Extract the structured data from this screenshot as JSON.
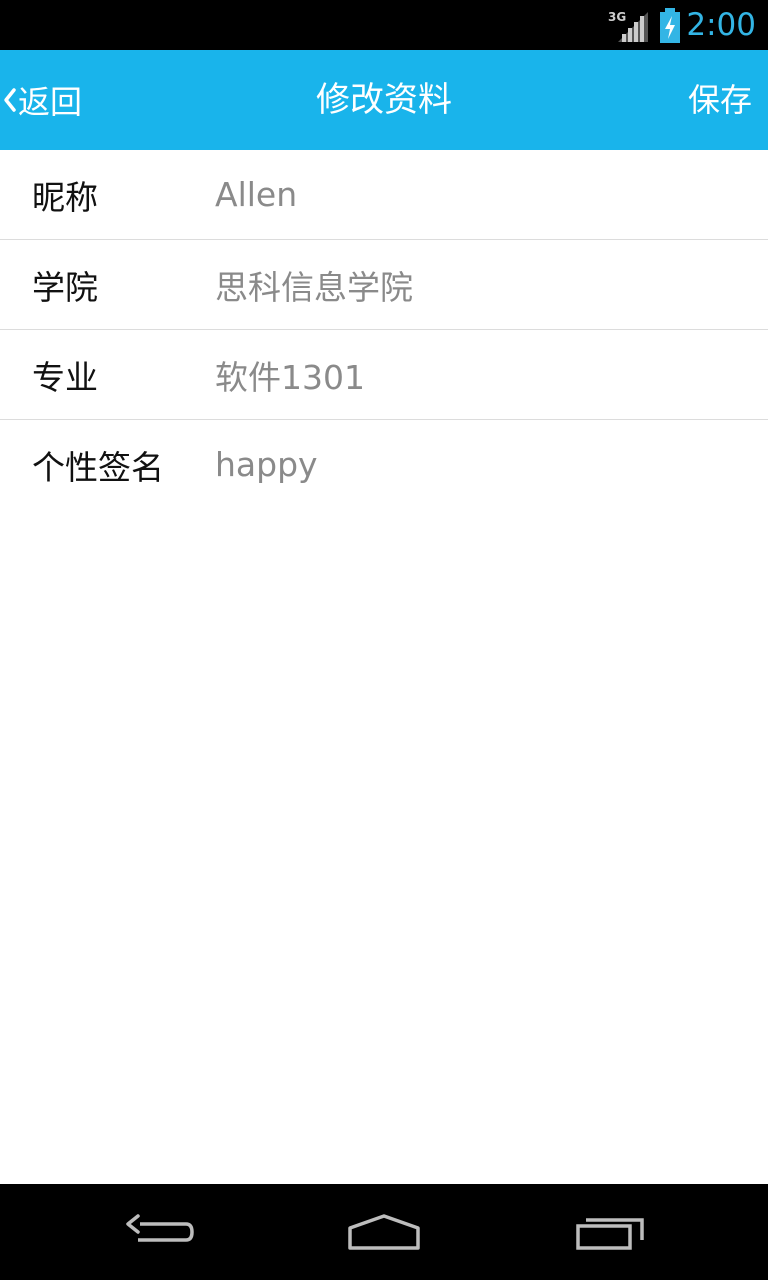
{
  "status_bar": {
    "network_label": "3G",
    "time": "2:00",
    "time_color": "#33b5e5",
    "icons": [
      "signal-3g-icon",
      "battery-charging-icon"
    ]
  },
  "header": {
    "background_color": "#19b4eb",
    "back_label": "返回",
    "title": "修改资料",
    "save_label": "保存"
  },
  "form": {
    "fields": [
      {
        "label": "昵称",
        "value": "Allen"
      },
      {
        "label": "学院",
        "value": "思科信息学院"
      },
      {
        "label": "专业",
        "value": "软件1301"
      },
      {
        "label": "个性签名",
        "value": "happy"
      }
    ]
  },
  "nav_bar": {
    "icons": [
      "back-nav-icon",
      "home-nav-icon",
      "recent-apps-icon"
    ]
  }
}
